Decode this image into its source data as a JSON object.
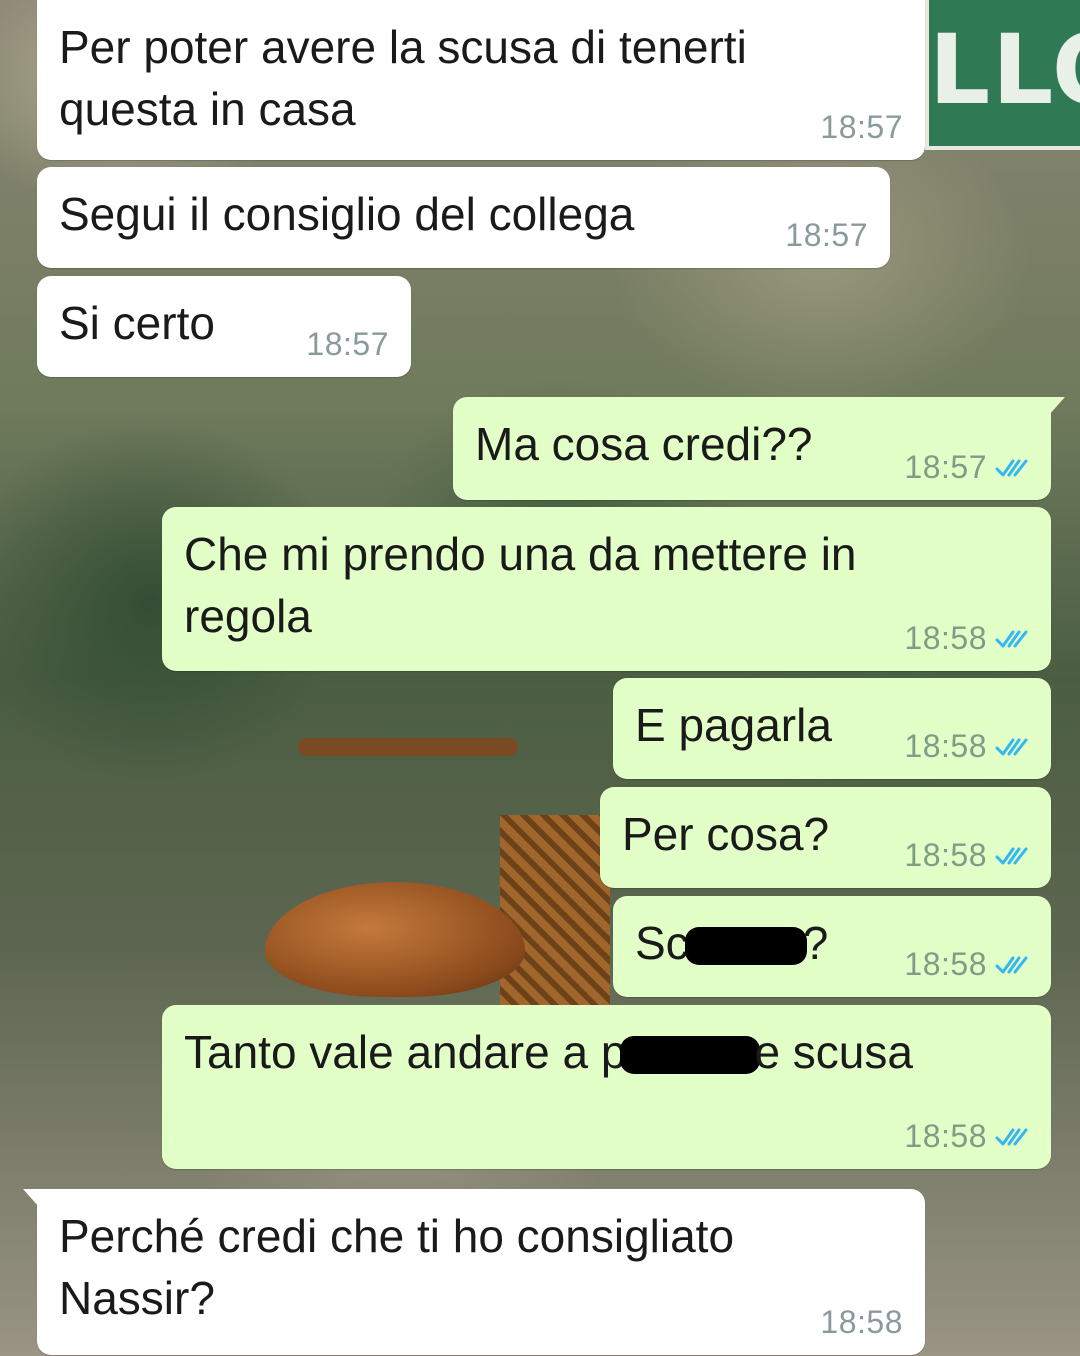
{
  "chat": {
    "messages": [
      {
        "id": "m1",
        "direction": "incoming",
        "text": "Per poter avere la scusa di tenerti questa in casa",
        "time": "18:57"
      },
      {
        "id": "m2",
        "direction": "incoming",
        "text": "Segui il consiglio del collega",
        "time": "18:57"
      },
      {
        "id": "m3",
        "direction": "incoming",
        "text": "Si certo",
        "time": "18:57"
      },
      {
        "id": "m4",
        "direction": "outgoing",
        "text": "Ma cosa credi??",
        "time": "18:57",
        "status": "read"
      },
      {
        "id": "m5",
        "direction": "outgoing",
        "text": "Che mi prendo una da mettere in regola",
        "time": "18:58",
        "status": "read"
      },
      {
        "id": "m6",
        "direction": "outgoing",
        "text": "E pagarla",
        "time": "18:58",
        "status": "read"
      },
      {
        "id": "m7",
        "direction": "outgoing",
        "text": "Per cosa?",
        "time": "18:58",
        "status": "read"
      },
      {
        "id": "m8",
        "direction": "outgoing",
        "text_before": "Sc",
        "text_after": "?",
        "redacted": true,
        "time": "18:58",
        "status": "read"
      },
      {
        "id": "m9",
        "direction": "outgoing",
        "text_before": "Tanto vale andare a p",
        "text_after": "e scusa",
        "redacted": true,
        "time": "18:58",
        "status": "read"
      },
      {
        "id": "m10",
        "direction": "incoming",
        "text": "Perché credi che ti ho consigliato Nassir?",
        "time": "18:58"
      }
    ]
  },
  "wallpaper": {
    "sign_text": "LLOW"
  },
  "colors": {
    "incoming_bubble": "#ffffff",
    "outgoing_bubble": "#e2ffc8",
    "read_ticks": "#34b7f1",
    "timestamp": "#8a9a9a"
  },
  "icons": {
    "read_receipt": "double-check-icon"
  }
}
